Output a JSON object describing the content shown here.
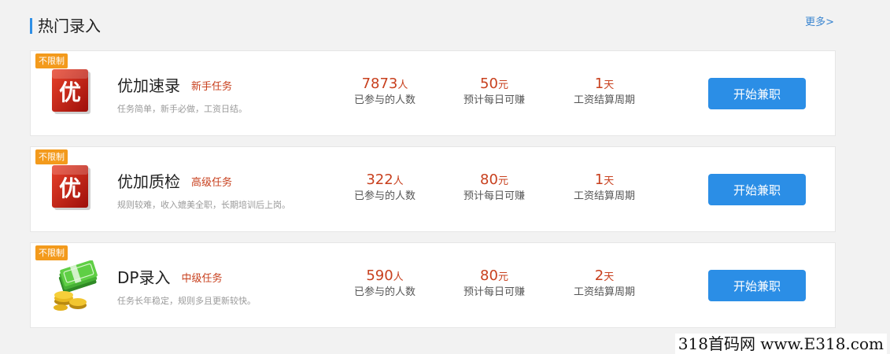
{
  "section": {
    "title": "热门录入",
    "more_label": "更多>"
  },
  "tasks": [
    {
      "badge": "不限制",
      "logo_icon": "you-logo-icon",
      "logo_glyph": "优",
      "name": "优加速录",
      "level": "新手任务",
      "description": "任务简单，新手必做，工资日结。",
      "participants": "7873",
      "participants_unit": "人",
      "participants_label": "已参与的人数",
      "daily_earning": "50",
      "daily_earning_unit": "元",
      "daily_earning_label": "预计每日可赚",
      "cycle": "1",
      "cycle_unit": "天",
      "cycle_label": "工资结算周期",
      "button_label": "开始兼职"
    },
    {
      "badge": "不限制",
      "logo_icon": "you-logo-icon",
      "logo_glyph": "优",
      "name": "优加质检",
      "level": "高级任务",
      "description": "规则较难，收入媲美全职，长期培训后上岗。",
      "participants": "322",
      "participants_unit": "人",
      "participants_label": "已参与的人数",
      "daily_earning": "80",
      "daily_earning_unit": "元",
      "daily_earning_label": "预计每日可赚",
      "cycle": "1",
      "cycle_unit": "天",
      "cycle_label": "工资结算周期",
      "button_label": "开始兼职"
    },
    {
      "badge": "不限制",
      "logo_icon": "money-coins-icon",
      "name": "DP录入",
      "level": "中级任务",
      "description": "任务长年稳定，规则多且更新较快。",
      "participants": "590",
      "participants_unit": "人",
      "participants_label": "已参与的人数",
      "daily_earning": "80",
      "daily_earning_unit": "元",
      "daily_earning_label": "预计每日可赚",
      "cycle": "2",
      "cycle_unit": "天",
      "cycle_label": "工资结算周期",
      "button_label": "开始兼职"
    }
  ],
  "watermark": "318首码网 www.E318.com",
  "colors": {
    "accent_blue": "#2b8ee6",
    "highlight_red": "#c8401e",
    "badge_orange": "#f39a1c"
  }
}
